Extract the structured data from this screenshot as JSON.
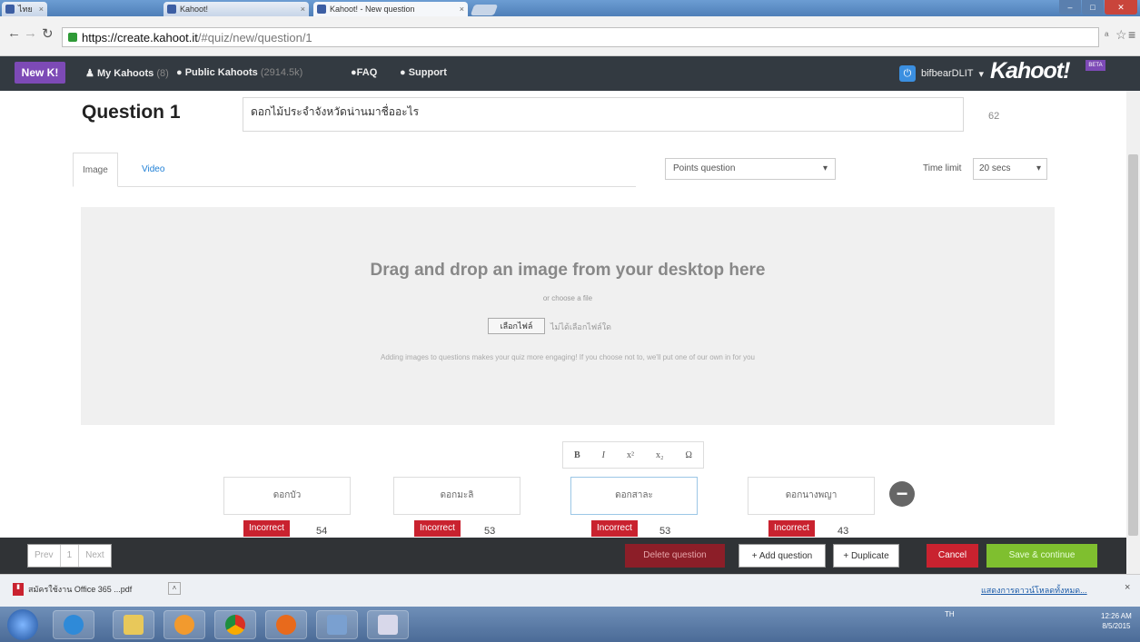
{
  "browser": {
    "tabs": [
      {
        "label": "ไทย"
      },
      {
        "label": "Kahoot!"
      },
      {
        "label": "Kahoot! - New question"
      }
    ],
    "url_host": "https://create.kahoot.it",
    "url_path": "/#quiz/new/question/1"
  },
  "nav": {
    "new_k": "New K!",
    "my_kahoots": "My Kahoots",
    "my_kahoots_count": "(8)",
    "public_kahoots": "Public Kahoots",
    "public_kahoots_count": "(2914.5k)",
    "faq": "FAQ",
    "support": "Support",
    "user": "bifbearDLIT",
    "logo": "Kahoot!",
    "beta": "BETA"
  },
  "question": {
    "title": "Question 1",
    "text": "ดอกไม้ประจำจังหวัดน่านมาชื่ออะไร",
    "char_count": "62"
  },
  "media": {
    "tab_image": "Image",
    "tab_video": "Video",
    "points_select": "Points question",
    "time_limit_label": "Time limit",
    "time_limit_value": "20 secs",
    "drop_heading": "Drag and drop an image from your desktop here",
    "drop_or": "or choose a file",
    "file_button": "เลือกไฟล์",
    "file_none": "ไม่ได้เลือกไฟล์ใด",
    "drop_note": "Adding images to questions makes your quiz more engaging! If you choose not to, we'll put one of our own in for you"
  },
  "format_toolbar": {
    "bold": "B",
    "italic": "I",
    "sup": "x²",
    "sub": "x₂",
    "omega": "Ω"
  },
  "answers": [
    {
      "text": "ดอกบัว",
      "status": "Incorrect",
      "count": "54"
    },
    {
      "text": "ดอกมะลิ",
      "status": "Incorrect",
      "count": "53"
    },
    {
      "text": "ดอกสาละ",
      "status": "Incorrect",
      "count": "53"
    },
    {
      "text": "ดอกนางพญา",
      "status": "Incorrect",
      "count": "43"
    }
  ],
  "footer": {
    "prev": "Prev",
    "page": "1",
    "next": "Next",
    "delete": "Delete question",
    "add": "+ Add question",
    "duplicate": "+ Duplicate",
    "cancel": "Cancel",
    "save": "Save & continue"
  },
  "downloads": {
    "file": "สมัครใช้งาน Office 365 ...pdf",
    "show_all": "แสดงการดาวน์โหลดทั้งหมด..."
  },
  "taskbar": {
    "tray": "TH",
    "time": "12:26 AM",
    "date": "8/5/2015"
  },
  "colors": {
    "nav_bg": "#333a41",
    "new_k": "#7d4ab6",
    "incorrect": "#c9222f",
    "save": "#7fbf2f",
    "link": "#1e7fd6"
  }
}
